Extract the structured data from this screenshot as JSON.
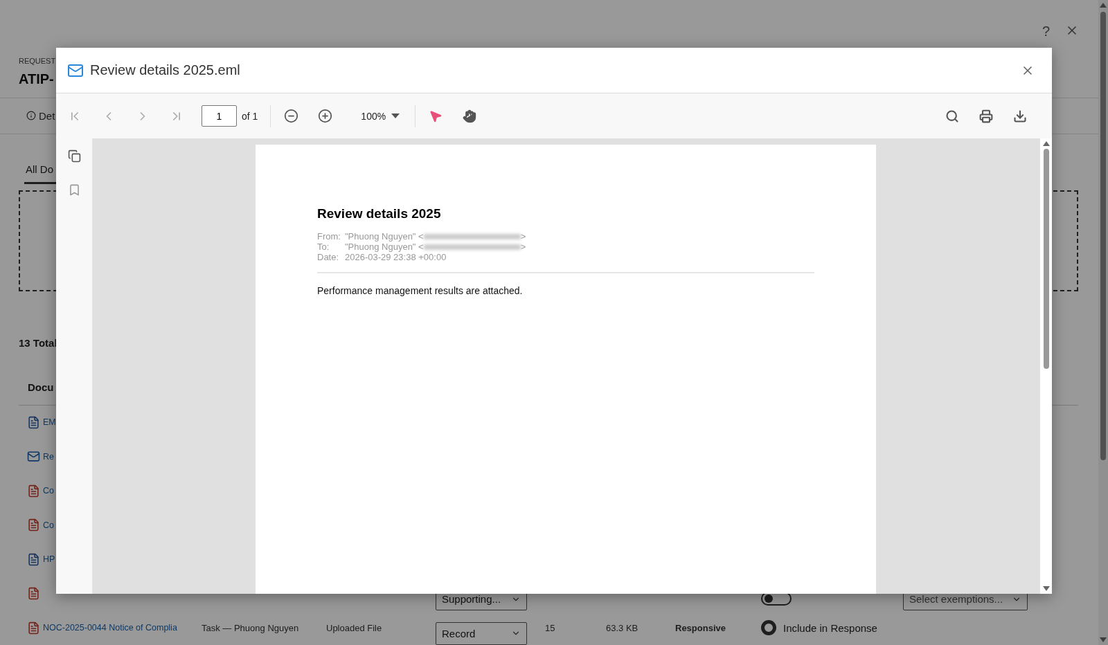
{
  "background": {
    "help_glyph": "?",
    "request_label": "REQUEST",
    "request_id": "ATIP-",
    "details_tab": "Det",
    "doc_tabs": [
      {
        "label": "All Do",
        "selected": true
      }
    ],
    "total": "13 Total",
    "column_1": "Docu",
    "rows": [
      {
        "kind": "word",
        "name": "EM"
      },
      {
        "kind": "mail",
        "name": "Re"
      },
      {
        "kind": "pdf",
        "name": "Co"
      },
      {
        "kind": "pdf",
        "name": "Co"
      },
      {
        "kind": "word",
        "name": "HP"
      },
      {
        "kind": "pdf",
        "category": "Supporting...",
        "inclusion": {
          "kind": "toggle",
          "on": false
        },
        "exemptions": {
          "placeholder": "Select exemptions..."
        }
      },
      {
        "kind": "pdf",
        "name": "NOC-2025-0044 Notice of Complia",
        "source": "Task — Phuong Nguyen",
        "origin": "Uploaded File",
        "category": "Record",
        "pages": "15",
        "size": "63.3 KB",
        "status": "Responsive",
        "inclusion": {
          "kind": "radio",
          "selected": true,
          "label": "Include in Response"
        }
      }
    ]
  },
  "viewer": {
    "title": "Review details 2025.eml",
    "page_input": "1",
    "page_count": "of 1",
    "zoom": "100%",
    "tools": [
      {
        "kind": "select",
        "selected": true
      },
      {
        "kind": "pan",
        "selected": false
      }
    ],
    "document": {
      "heading": "Review details 2025",
      "meta": [
        {
          "label": "From:",
          "value": "\"Phuong Nguyen\" <",
          "end": ">"
        },
        {
          "label": "To:",
          "value": "\"Phuong Nguyen\" <",
          "end": ">"
        },
        {
          "label": "Date:",
          "value": "2026-03-29 23:38 +00:00"
        }
      ],
      "body": "Performance management results are attached."
    }
  }
}
